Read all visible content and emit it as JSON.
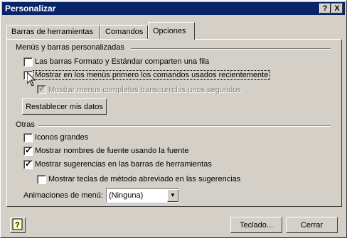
{
  "window": {
    "title": "Personalizar",
    "help_btn": "?",
    "close_btn": "X"
  },
  "tabs": [
    {
      "label": "Barras de herramientas",
      "mnemonic": "B"
    },
    {
      "label": "Comandos",
      "mnemonic": "C"
    },
    {
      "label": "Opciones",
      "mnemonic": "O",
      "active": true
    }
  ],
  "groups": {
    "menus": {
      "label": "Menús y barras personalizadas"
    },
    "others": {
      "label": "Otras"
    }
  },
  "options": {
    "share_row": {
      "label": "Las barras Formato y Estándar comparten una fila",
      "checked": false,
      "enabled": true
    },
    "recent_first": {
      "label": "Mostrar en los menús primero los comandos usados recientemente",
      "checked": false,
      "enabled": true
    },
    "full_menus": {
      "label": "Mostrar menús completos transcurridos unos segundos",
      "checked": true,
      "enabled": false
    },
    "large_icons": {
      "label": "Iconos grandes",
      "checked": false,
      "enabled": true
    },
    "font_names": {
      "label": "Mostrar nombres de fuente usando la fuente",
      "checked": true,
      "enabled": true
    },
    "tooltips": {
      "label": "Mostrar sugerencias en las barras de herramientas",
      "checked": true,
      "enabled": true
    },
    "shortcut_keys": {
      "label": "Mostrar teclas de método abreviado en las sugerencias",
      "checked": false,
      "enabled": true
    }
  },
  "reset_button": {
    "label": "Restablecer mis datos"
  },
  "animations": {
    "label": "Animaciones de menú:",
    "value": "(Ninguna)"
  },
  "footer": {
    "keyboard_button": "Teclado...",
    "close_button": "Cerrar"
  },
  "icons": {
    "help": "help-icon",
    "close": "close-icon",
    "dropdown": "chevron-down-icon",
    "cursor": "mouse-pointer-icon"
  }
}
